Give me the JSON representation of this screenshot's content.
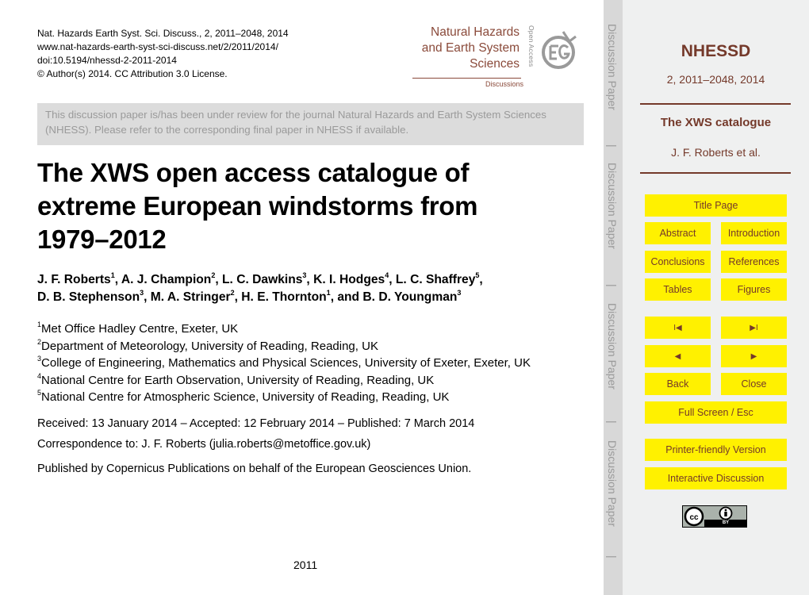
{
  "header": {
    "citation": "Nat. Hazards Earth Syst. Sci. Discuss., 2, 2011–2048, 2014",
    "url": "www.nat-hazards-earth-syst-sci-discuss.net/2/2011/2014/",
    "doi": "doi:10.5194/nhessd-2-2011-2014",
    "license": "© Author(s) 2014. CC Attribution 3.0 License."
  },
  "journal_logo": {
    "line1": "Natural Hazards",
    "line2": "and Earth System",
    "line3": "Sciences",
    "subtitle": "Discussions",
    "open_access": "Open Access",
    "emblem_icon": "egu-emblem-icon"
  },
  "review_banner": {
    "text": "This discussion paper is/has been under review for the journal Natural Hazards and Earth System Sciences (NHESS). Please refer to the corresponding final paper in NHESS if available."
  },
  "paper": {
    "title": "The XWS open access catalogue of extreme European windstorms from 1979–2012",
    "authors": [
      {
        "name": "J. F. Roberts",
        "aff": "1",
        "sep": ", "
      },
      {
        "name": "A. J. Champion",
        "aff": "2",
        "sep": ", "
      },
      {
        "name": "L. C. Dawkins",
        "aff": "3",
        "sep": ", "
      },
      {
        "name": "K. I. Hodges",
        "aff": "4",
        "sep": ", "
      },
      {
        "name": "L. C. Shaffrey",
        "aff": "5",
        "sep": ","
      },
      {
        "name": "D. B. Stephenson",
        "aff": "3",
        "sep": ", "
      },
      {
        "name": "M. A. Stringer",
        "aff": "2",
        "sep": ", "
      },
      {
        "name": "H. E. Thornton",
        "aff": "1",
        "sep": ", and "
      },
      {
        "name": "B. D. Youngman",
        "aff": "3",
        "sep": ""
      }
    ],
    "affiliations": [
      {
        "num": "1",
        "text": "Met Office Hadley Centre, Exeter, UK"
      },
      {
        "num": "2",
        "text": "Department of Meteorology, University of Reading, Reading, UK"
      },
      {
        "num": "3",
        "text": "College of Engineering, Mathematics and Physical Sciences, University of Exeter, Exeter, UK"
      },
      {
        "num": "4",
        "text": "National Centre for Earth Observation, University of Reading, Reading, UK"
      },
      {
        "num": "5",
        "text": "National Centre for Atmospheric Science, University of Reading, Reading, UK"
      }
    ],
    "dates": "Received: 13 January 2014 – Accepted: 12 February 2014 – Published: 7 March 2014",
    "correspondence": "Correspondence to: J. F. Roberts (julia.roberts@metoffice.gov.uk)",
    "publisher": "Published by Copernicus Publications on behalf of the European Geosciences Union.",
    "page_number": "2011"
  },
  "discussion_strip": {
    "label": "Discussion Paper",
    "separator": "|"
  },
  "sidebar": {
    "journal": "NHESS D",
    "journal_abbrev": "NHESSD",
    "volume": "2, 2011–2048, 2014",
    "short_title": "The XWS catalogue",
    "authors": "J. F. Roberts et al.",
    "buttons": {
      "title_page": "Title Page",
      "abstract": "Abstract",
      "introduction": "Introduction",
      "conclusions": "Conclusions",
      "references": "References",
      "tables": "Tables",
      "figures": "Figures",
      "first": "I◀",
      "last": "▶I",
      "prev": "◀",
      "next": "▶",
      "back": "Back",
      "close": "Close",
      "fullscreen": "Full Screen / Esc",
      "printer": "Printer-friendly Version",
      "interactive": "Interactive Discussion"
    },
    "cc_badge": {
      "cc": "cc",
      "by": "BY"
    }
  },
  "colors": {
    "brand_brown": "#74392a",
    "button_yellow": "#fff100",
    "sidebar_bg": "#eff0f0",
    "banner_bg": "#dcdcdc"
  }
}
